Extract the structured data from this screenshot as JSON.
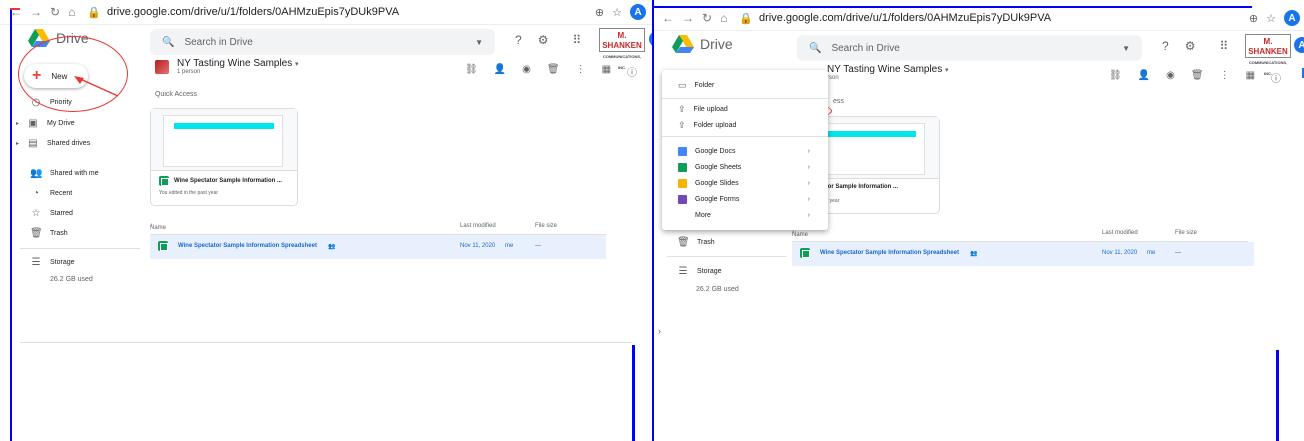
{
  "browser": {
    "url": "drive.google.com/drive/u/1/folders/0AHMzuEpis7yDUk9PVA",
    "nav_icons": [
      "back-icon",
      "forward-icon",
      "reload-icon",
      "home-icon"
    ],
    "avatar_letter": "A"
  },
  "app": {
    "name": "Drive",
    "search_placeholder": "Search in Drive",
    "brand_line1": "M. SHANKEN",
    "brand_line2": "COMMUNICATIONS, INC."
  },
  "sidebar": {
    "new_label": "New",
    "items": [
      {
        "label": "Priority",
        "icon": "priority-icon"
      },
      {
        "label": "My Drive",
        "icon": "my-drive-icon"
      },
      {
        "label": "Shared drives",
        "icon": "shared-drives-icon"
      },
      {
        "label": "Shared with me",
        "icon": "shared-with-me-icon"
      },
      {
        "label": "Recent",
        "icon": "recent-icon"
      },
      {
        "label": "Starred",
        "icon": "star-icon"
      },
      {
        "label": "Trash",
        "icon": "trash-icon"
      },
      {
        "label": "Storage",
        "icon": "storage-icon"
      }
    ],
    "storage_used": "26.2 GB used"
  },
  "folder": {
    "title": "NY Tasting Wine Samples",
    "subtitle": "1 person",
    "subtitle_partial": "rson",
    "title_partial": "NY Tasting Wine Samples"
  },
  "quick_access": {
    "label": "Quick Access",
    "label_partial": "ess",
    "card_title": "Wine Spectator Sample Information ...",
    "card_title_partial": "e Spectator Sample Information ...",
    "card_sub": "You edited in the past year",
    "card_sub_partial": "d in the past year"
  },
  "list": {
    "col_name": "Name",
    "col_name_partial": "Name",
    "col_modified": "Last modified",
    "col_size": "File size",
    "rows": [
      {
        "name": "Wine Spectator Sample Information Spreadsheet",
        "modified": "Nov 11, 2020",
        "owner": "me",
        "size": "—"
      }
    ]
  },
  "new_menu": {
    "items": [
      {
        "label": "Folder",
        "icon": "folder-icon"
      },
      {
        "label": "File upload",
        "icon": "file-upload-icon"
      },
      {
        "label": "Folder upload",
        "icon": "folder-upload-icon"
      },
      {
        "label": "Google Docs",
        "icon": "docs-icon",
        "color": "#4285f4"
      },
      {
        "label": "Google Sheets",
        "icon": "sheets-icon",
        "color": "#0f9d58"
      },
      {
        "label": "Google Slides",
        "icon": "slides-icon",
        "color": "#f4b400"
      },
      {
        "label": "Google Forms",
        "icon": "forms-icon",
        "color": "#7248b9"
      },
      {
        "label": "More",
        "icon": "more-icon"
      }
    ]
  },
  "colors": {
    "annotation_red": "#e53935",
    "annotation_blue": "#0000ff",
    "selected_row": "#e8f0fe"
  }
}
